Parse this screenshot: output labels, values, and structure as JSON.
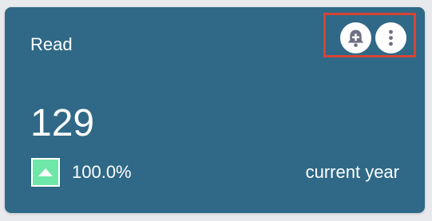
{
  "card": {
    "title": "Read",
    "metric_value": "129",
    "trend": {
      "direction": "up",
      "icon": "triangle-up-icon",
      "color": "#6ee7a8",
      "percent": "100.0%"
    },
    "period": "current year",
    "background_color": "#2f6987"
  },
  "actions": {
    "add_alert_icon": "bell-plus-icon",
    "more_icon": "more-vertical-icon",
    "highlight_color": "#d64535"
  }
}
